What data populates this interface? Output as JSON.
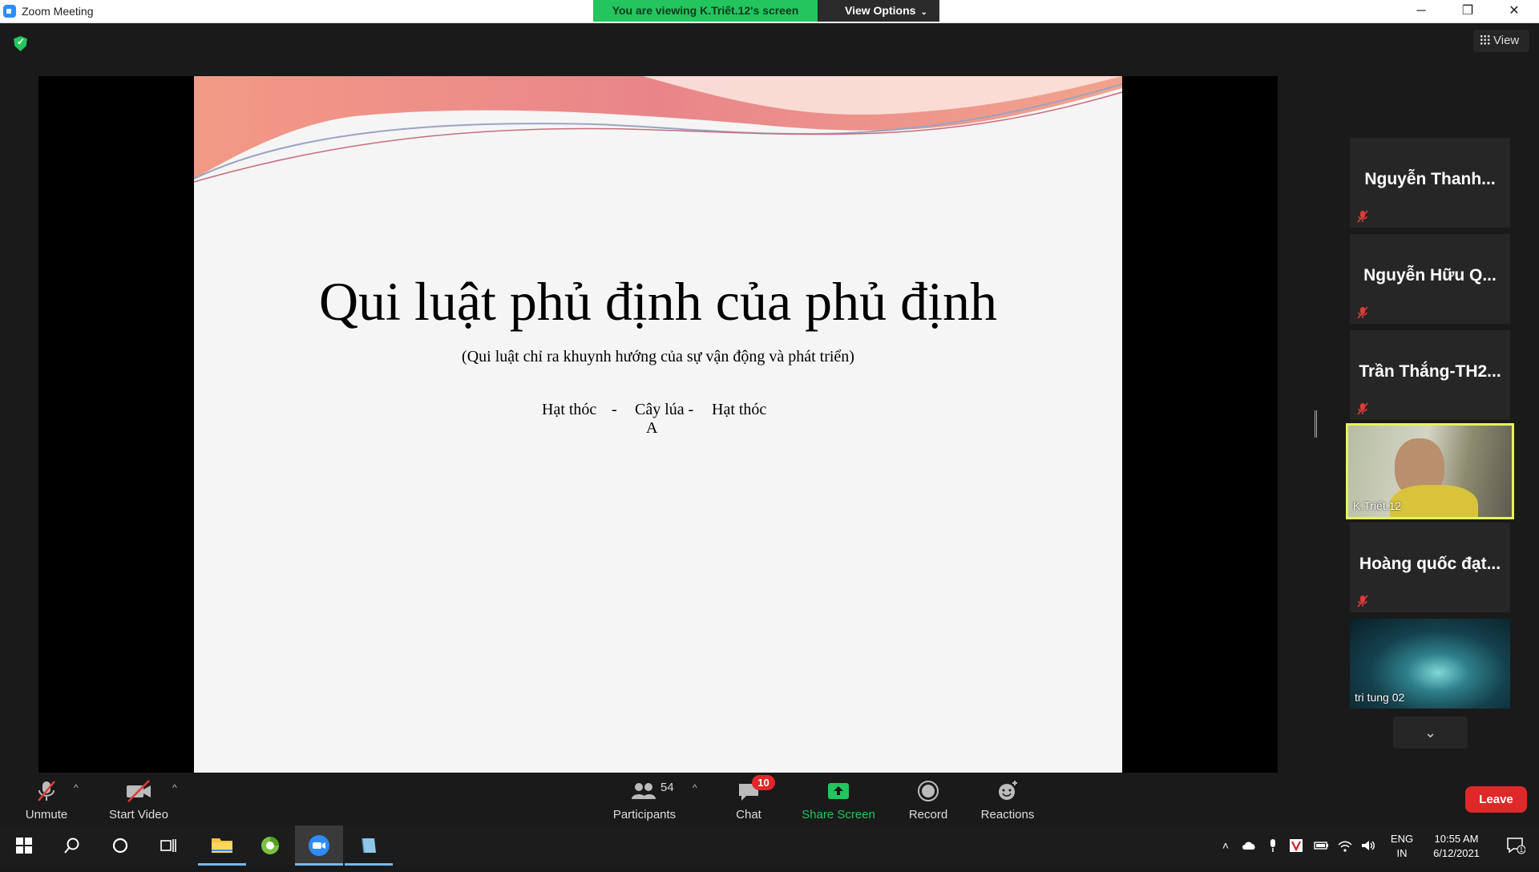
{
  "window": {
    "title": "Zoom Meeting",
    "minimize": "─",
    "restore": "❐",
    "close": "✕"
  },
  "banner": {
    "viewing": "You are viewing K.Triết.12's screen",
    "view_options": "View Options",
    "view_options_caret": "⌄"
  },
  "top": {
    "view_label": "View"
  },
  "slide": {
    "title": "Qui luật phủ định của phủ định",
    "subtitle": "(Qui luật chỉ ra khuynh hướng của sự vận động và phát triển)",
    "item1": "Hạt thóc",
    "dash1": "-",
    "item2": "Cây lúa -",
    "item2_sub": "A",
    "item3": "Hạt thóc"
  },
  "participants_gallery": [
    {
      "name": "Nguyễn Thanh...",
      "muted": true
    },
    {
      "name": "Nguyễn Hữu Q...",
      "muted": true
    },
    {
      "name": "Trần Thắng-TH2...",
      "muted": true
    },
    {
      "name": "K.Triết.12",
      "video": true,
      "active_speaker": true
    },
    {
      "name": "Hoàng quốc đạt...",
      "muted": true
    },
    {
      "name": "tri tung 02",
      "video": true
    }
  ],
  "gallery_scroll": "⌄",
  "toolbar": {
    "unmute": "Unmute",
    "start_video": "Start Video",
    "participants": "Participants",
    "participants_count": "54",
    "chat": "Chat",
    "chat_badge": "10",
    "share_screen": "Share Screen",
    "record": "Record",
    "reactions": "Reactions",
    "leave": "Leave",
    "caret": "^"
  },
  "taskbar": {
    "lang_top": "ENG",
    "lang_bottom": "IN",
    "time": "10:55 AM",
    "date": "6/12/2021",
    "notification_count": "1"
  },
  "colors": {
    "share_green": "#23c55e",
    "leave_red": "#e02828",
    "active_speaker": "#e6f25c"
  }
}
